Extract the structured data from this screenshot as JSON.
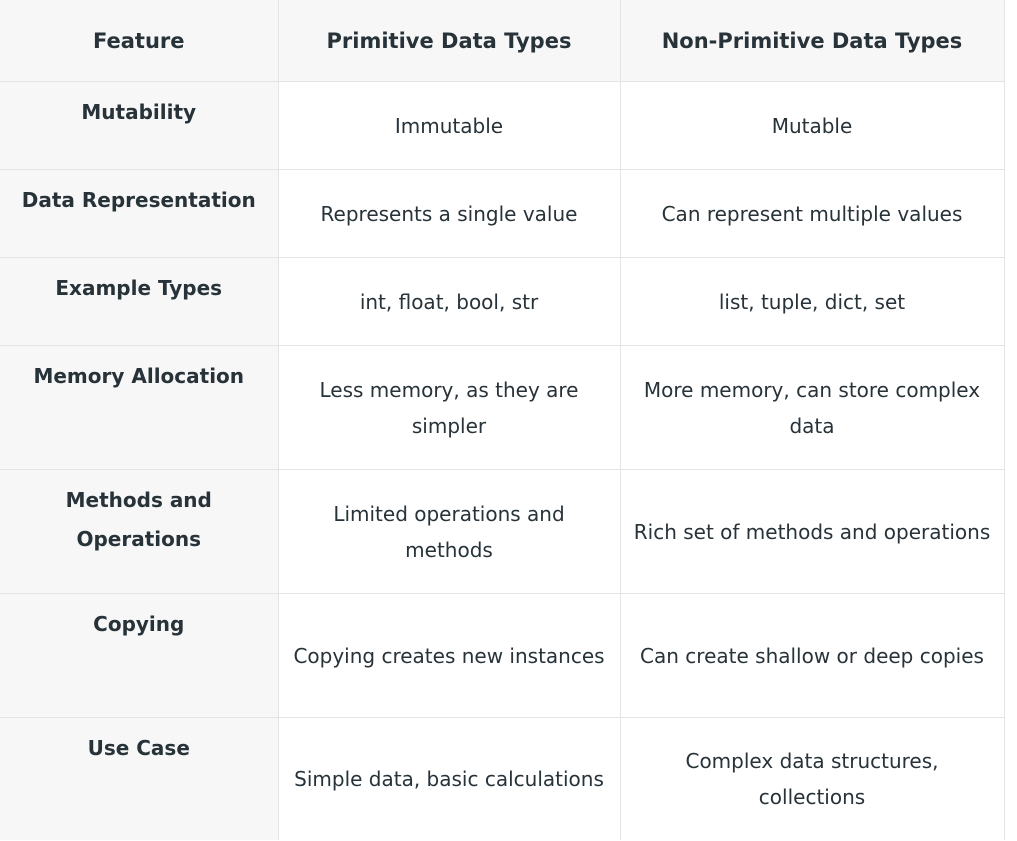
{
  "table": {
    "headers": [
      "Feature",
      "Primitive Data Types",
      "Non-Primitive Data Types"
    ],
    "rows": [
      {
        "feature": "Mutability",
        "primitive": "Immutable",
        "non_primitive": "Mutable"
      },
      {
        "feature": "Data Representation",
        "primitive": "Represents a single value",
        "non_primitive": "Can represent multiple values"
      },
      {
        "feature": "Example Types",
        "primitive": "int, float, bool, str",
        "non_primitive": "list, tuple, dict, set"
      },
      {
        "feature": "Memory Allocation",
        "primitive": "Less memory, as they are simpler",
        "non_primitive": "More memory, can store complex data"
      },
      {
        "feature": "Methods and Operations",
        "primitive": "Limited operations and methods",
        "non_primitive": "Rich set of methods and operations"
      },
      {
        "feature": "Copying",
        "primitive": "Copying creates new instances",
        "non_primitive": "Can create shallow or deep copies"
      },
      {
        "feature": "Use Case",
        "primitive": "Simple data, basic calculations",
        "non_primitive": "Complex data structures, collections"
      }
    ]
  }
}
